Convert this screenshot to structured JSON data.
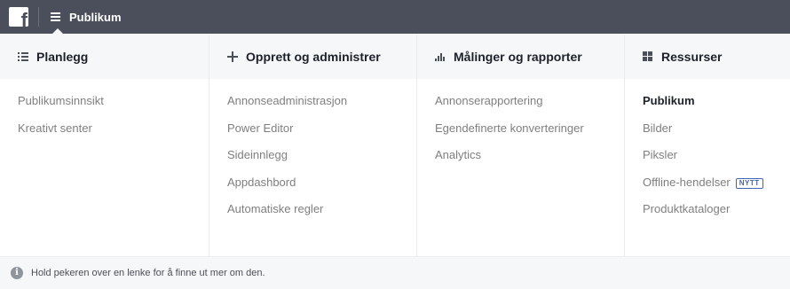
{
  "header": {
    "logo_icon": "facebook-logo-icon",
    "menu_icon": "hamburger-icon",
    "title": "Publikum"
  },
  "columns": [
    {
      "icon": "list-icon",
      "title": "Planlegg",
      "items": [
        {
          "label": "Publikumsinnsikt"
        },
        {
          "label": "Kreativt senter"
        }
      ]
    },
    {
      "icon": "plus-icon",
      "title": "Opprett og administrer",
      "items": [
        {
          "label": "Annonseadministrasjon"
        },
        {
          "label": "Power Editor"
        },
        {
          "label": "Sideinnlegg"
        },
        {
          "label": "Appdashbord"
        },
        {
          "label": "Automatiske regler"
        }
      ]
    },
    {
      "icon": "bar-chart-icon",
      "title": "Målinger og rapporter",
      "items": [
        {
          "label": "Annonserapportering"
        },
        {
          "label": "Egendefinerte konverteringer"
        },
        {
          "label": "Analytics"
        }
      ]
    },
    {
      "icon": "grid-icon",
      "title": "Ressurser",
      "items": [
        {
          "label": "Publikum",
          "active": true
        },
        {
          "label": "Bilder"
        },
        {
          "label": "Piksler"
        },
        {
          "label": "Offline-hendelser",
          "badge": "NYTT"
        },
        {
          "label": "Produktkataloger"
        }
      ]
    }
  ],
  "footer": {
    "icon": "info-icon",
    "text": "Hold pekeren over en lenke for å finne ut mer om den."
  },
  "colors": {
    "topbar": "#4b4f5c",
    "header_bg": "#f6f7f9",
    "link_gray": "#7f7f7f",
    "badge_blue": "#4267b2"
  }
}
